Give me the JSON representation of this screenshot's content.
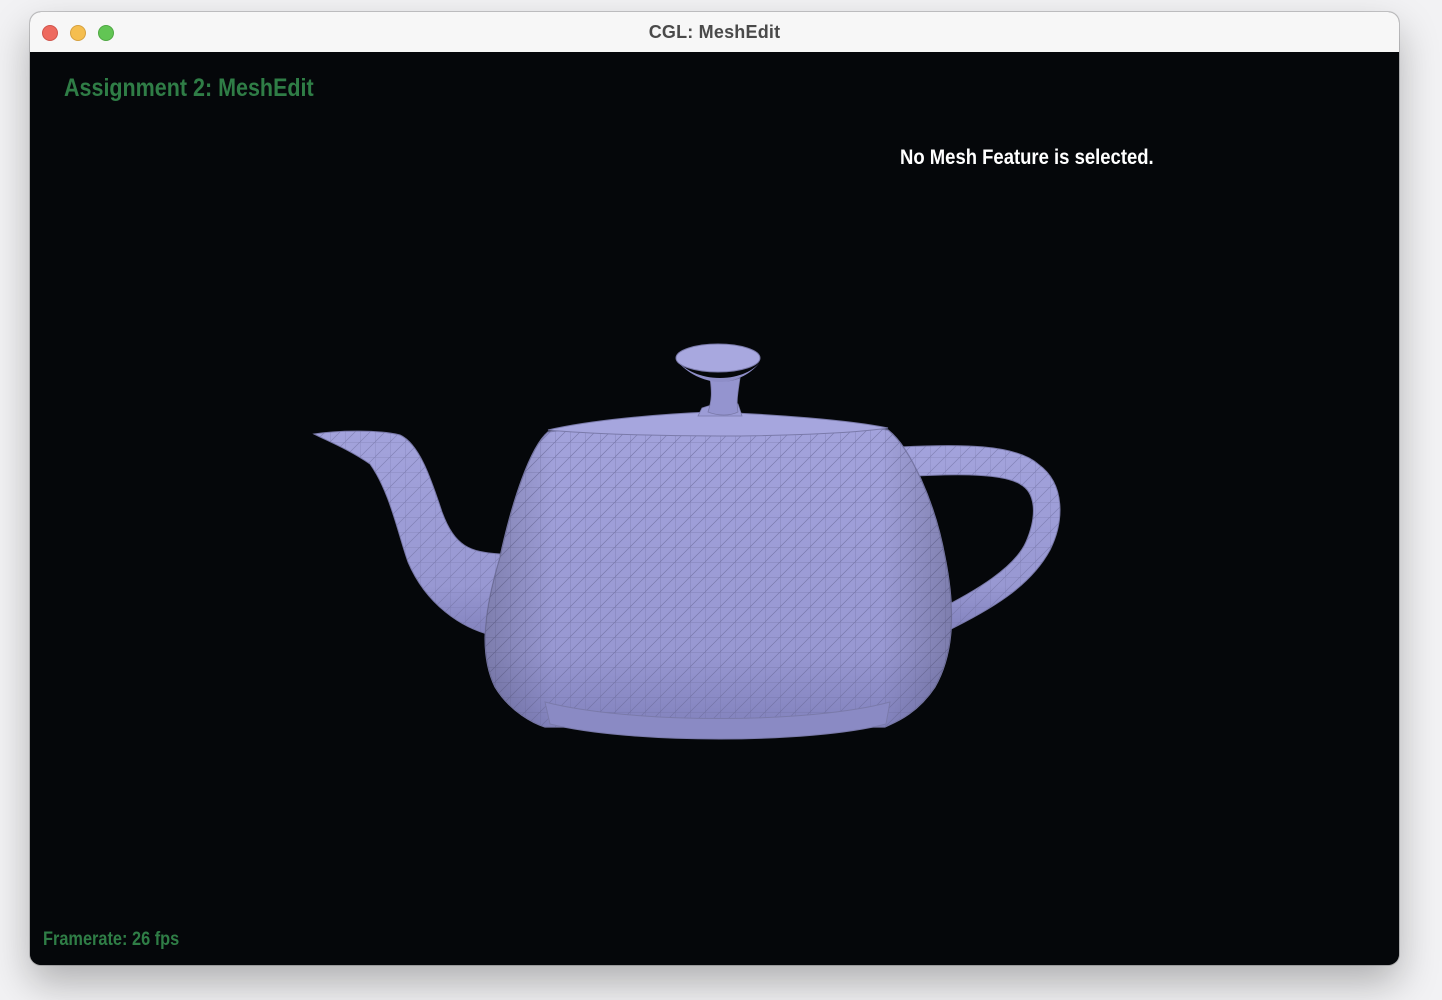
{
  "window": {
    "title": "CGL: MeshEdit"
  },
  "hud": {
    "title": "Assignment 2: MeshEdit",
    "status": "No Mesh Feature is selected.",
    "framerate": "Framerate: 26 fps"
  },
  "colors": {
    "hud_accent": "#2f7d46",
    "status_text": "#ffffff",
    "background": "#05070a",
    "mesh_fill": "#9a9ad6",
    "mesh_wire": "#6e6e9e"
  },
  "icons": {
    "close": "close-traffic-light",
    "minimize": "minimize-traffic-light",
    "zoom": "zoom-traffic-light"
  }
}
